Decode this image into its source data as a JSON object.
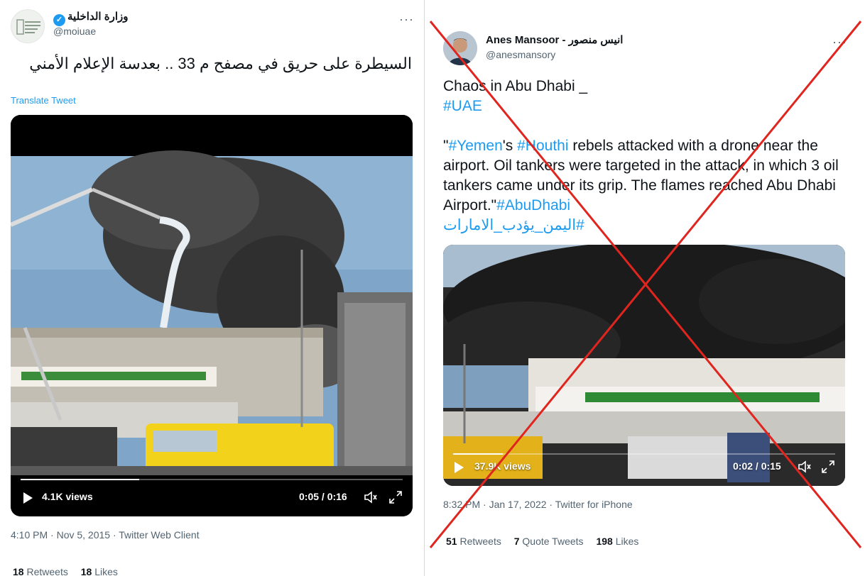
{
  "left_tweet": {
    "display_name": "وزارة الداخلية",
    "handle": "@moiuae",
    "text": "السيطرة على حريق في مصفح م 33 .. بعدسة الإعلام الأمني",
    "translate_label": "Translate Tweet",
    "video": {
      "views": "4.1K views",
      "time": "0:05 / 0:16",
      "progress": 0.31
    },
    "meta": "4:10 PM · Nov 5, 2015 · Twitter Web Client",
    "retweets_count": "18",
    "retweets_label": "Retweets",
    "likes_count": "18",
    "likes_label": "Likes"
  },
  "right_tweet": {
    "display_name": "Anes Mansoor - انيس منصور",
    "handle": "@anesmansory",
    "text_line1": "Chaos in Abu Dhabi _",
    "hashtag_uae": "#UAE",
    "quote_open": "\"",
    "hashtag_yemen": "#Yemen",
    "text_s": "'s ",
    "hashtag_houthi": "#Houthi",
    "text_body": " rebels attacked with a drone near the airport. Oil tankers were targeted in the attack, in which 3 oil tankers came under its grip. The flames reached Abu Dhabi Airport.\"",
    "hashtag_abudhabi": "#AbuDhabi",
    "hashtag_arabic": "#اليمن_يؤدب_الامارات",
    "video": {
      "views": "37.9K views",
      "time": "0:02 / 0:15",
      "progress": 0.13
    },
    "meta": "8:32 PM · Jan 17, 2022 · Twitter for iPhone",
    "retweets_count": "51",
    "retweets_label": "Retweets",
    "quote_count": "7",
    "quote_label": "Quote Tweets",
    "likes_count": "198",
    "likes_label": "Likes"
  },
  "more_label": "···",
  "colors": {
    "accent": "#1d9bf0",
    "cross": "#e0251f",
    "secondary_text": "#536471"
  },
  "icons": [
    "verified-badge-icon",
    "play-icon",
    "volume-icon",
    "fullscreen-icon",
    "more-icon"
  ]
}
